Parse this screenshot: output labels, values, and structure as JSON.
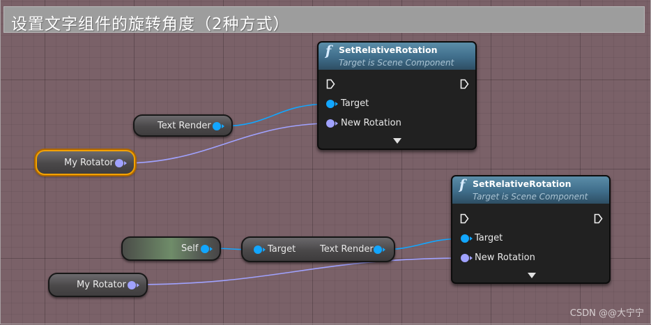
{
  "comment": {
    "title": "设置文字组件的旋转角度（2种方式）"
  },
  "colors": {
    "object_pin": "#12a6ff",
    "rotator_pin": "#a0a2ff",
    "selection_outline": "#f3a200",
    "function_header": "#4a7a96"
  },
  "variables": {
    "text_render_1": {
      "label": "Text Render",
      "pin_icon": "object-pin-icon"
    },
    "my_rotator_1": {
      "label": "My Rotator",
      "pin_icon": "rotator-pin-icon",
      "selected": true
    },
    "self": {
      "label": "Self",
      "pin_icon": "object-pin-icon"
    },
    "my_rotator_2": {
      "label": "My Rotator",
      "pin_icon": "rotator-pin-icon"
    }
  },
  "getter": {
    "input_label": "Target",
    "output_label": "Text Render"
  },
  "function_nodes": [
    {
      "icon": "function-icon",
      "icon_glyph": "f",
      "title": "SetRelativeRotation",
      "subtitle": "Target is Scene Component",
      "pins": {
        "target": "Target",
        "new_rotation": "New Rotation"
      }
    },
    {
      "icon": "function-icon",
      "icon_glyph": "f",
      "title": "SetRelativeRotation",
      "subtitle": "Target is Scene Component",
      "pins": {
        "target": "Target",
        "new_rotation": "New Rotation"
      }
    }
  ],
  "watermark": "CSDN @@大宁宁"
}
